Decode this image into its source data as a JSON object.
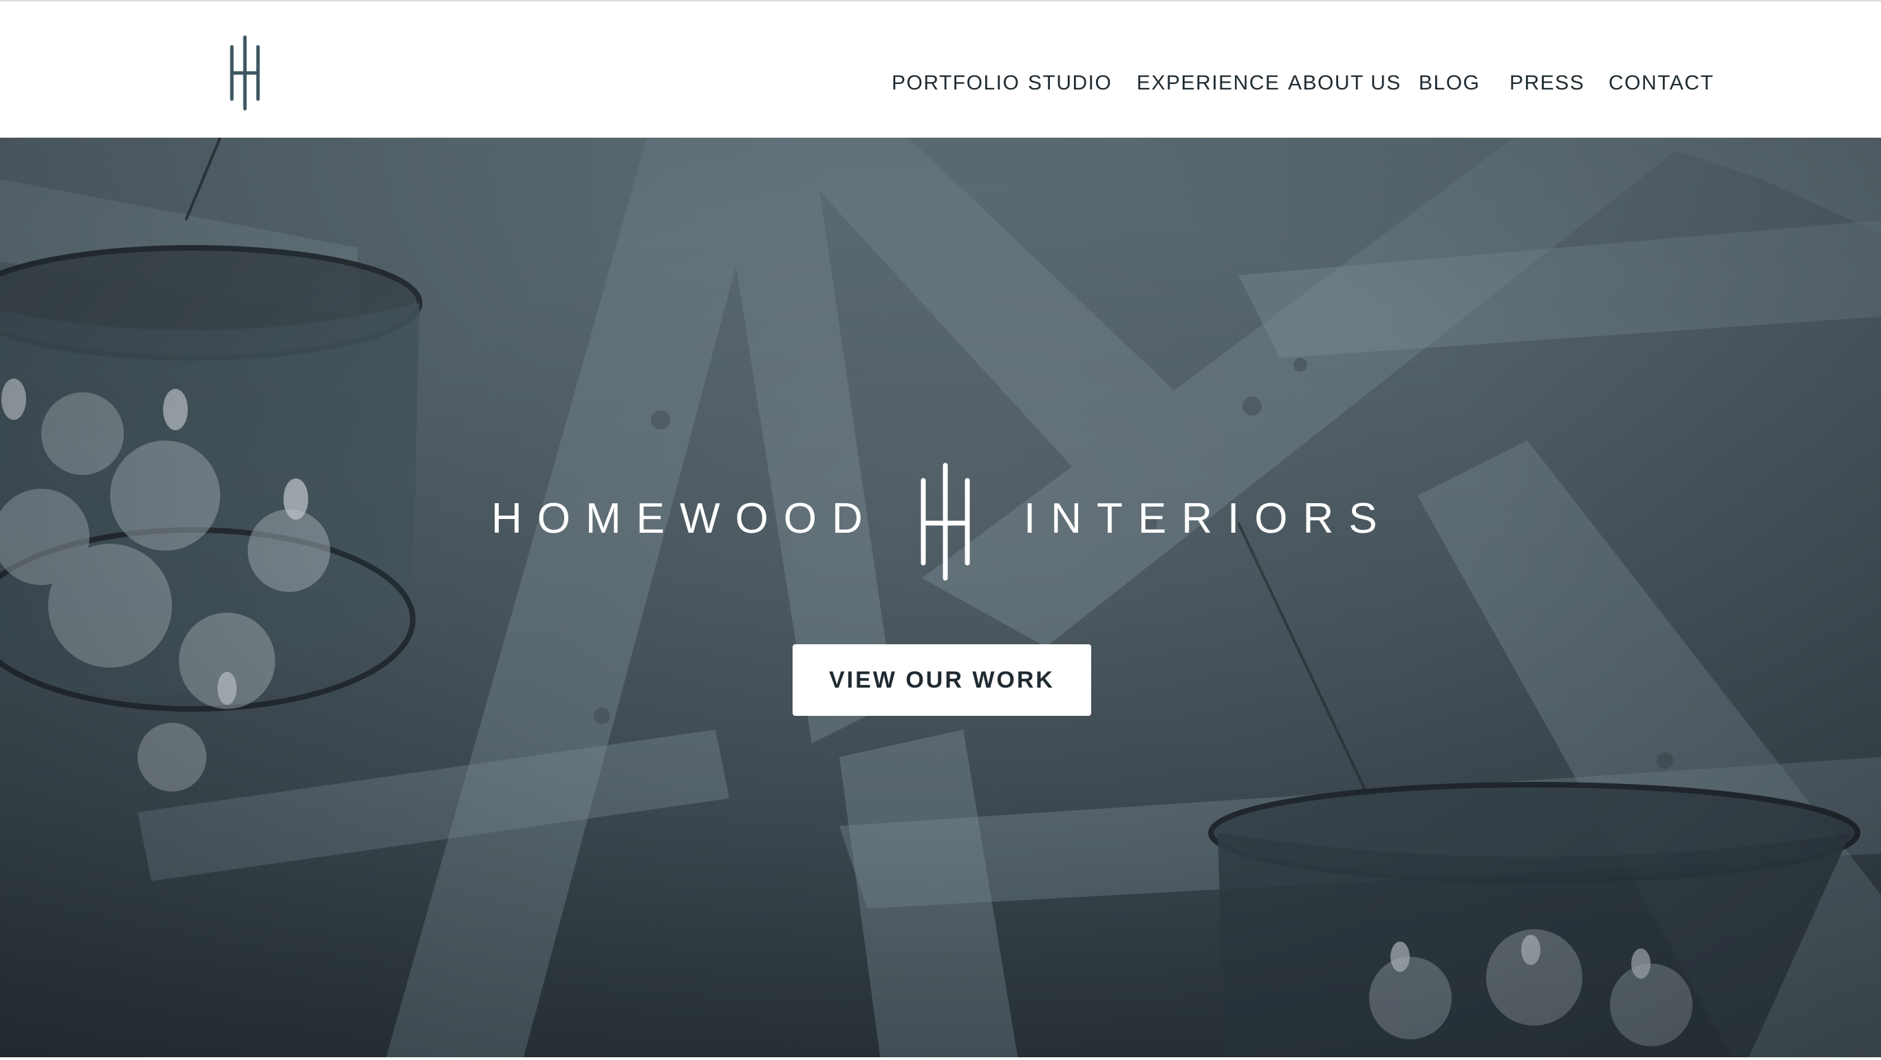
{
  "header": {
    "logo_icon": "hh-monogram-icon",
    "nav": {
      "portfolio": "PORTFOLIO",
      "studio": "STUDIO",
      "experience": "EXPERIENCE",
      "about": "ABOUT US",
      "blog": "BLOG",
      "press": "PRESS",
      "contact": "CONTACT"
    }
  },
  "hero": {
    "brand_left": "HOMEWOOD",
    "brand_right": "INTERIORS",
    "brand_icon": "hh-monogram-icon",
    "cta_label": "VIEW OUR WORK",
    "background": "chandeliers-and-wood-beams-photo"
  },
  "colors": {
    "accent": "#3d5660",
    "nav_text": "#1f2a31",
    "hero_overlay": "#4c5961",
    "button_bg": "#ffffff"
  }
}
